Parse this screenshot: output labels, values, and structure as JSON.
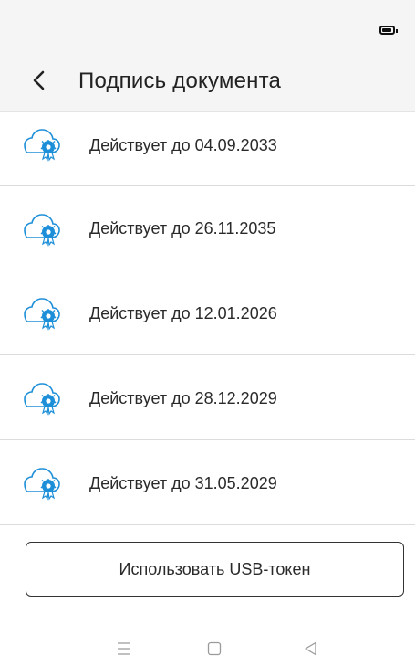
{
  "status_bar": {
    "battery_icon": "battery-icon"
  },
  "header": {
    "back_icon": "chevron-left-icon",
    "title": "Подпись документа"
  },
  "certificates": [
    {
      "label": "Действует до 04.09.2033",
      "icon": "cloud-certificate-icon"
    },
    {
      "label": "Действует до 26.11.2035",
      "icon": "cloud-certificate-icon"
    },
    {
      "label": "Действует до 12.01.2026",
      "icon": "cloud-certificate-icon"
    },
    {
      "label": "Действует до 28.12.2029",
      "icon": "cloud-certificate-icon"
    },
    {
      "label": "Действует до 31.05.2029",
      "icon": "cloud-certificate-icon"
    }
  ],
  "footer": {
    "usb_button_label": "Использовать USB-токен"
  },
  "nav_bar": {
    "menu_icon": "menu-icon",
    "home_icon": "home-square-icon",
    "back_icon": "back-triangle-icon"
  },
  "colors": {
    "accent": "#1d8fd8",
    "header_bg": "#f5f5f5",
    "divider": "#dcdcdc"
  }
}
